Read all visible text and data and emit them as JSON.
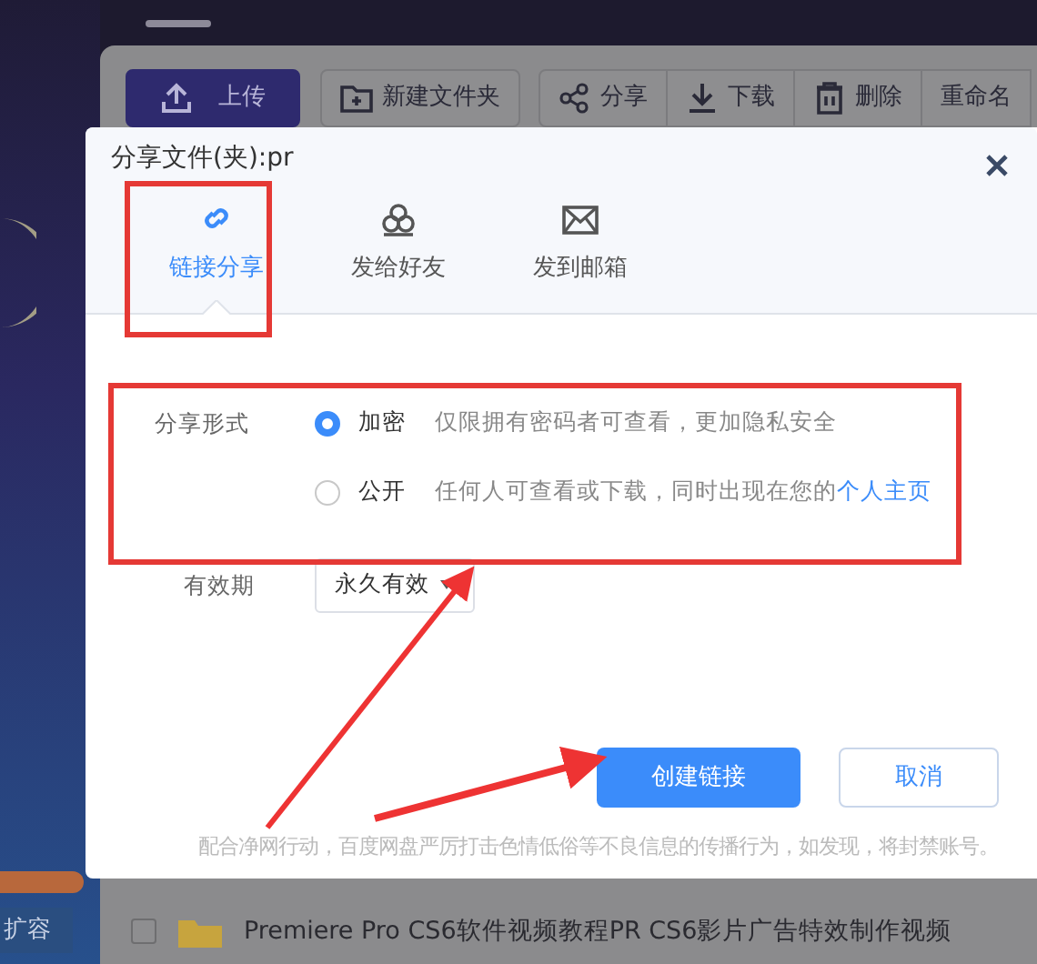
{
  "toolbar": {
    "buttons": [
      {
        "label": "上传",
        "kind": "primary"
      },
      {
        "label": "新建文件夹",
        "kind": "single"
      },
      {
        "label": "分享",
        "kind": "group"
      },
      {
        "label": "下载",
        "kind": "group"
      },
      {
        "label": "删除",
        "kind": "group"
      },
      {
        "label": "重命名",
        "kind": "group"
      }
    ]
  },
  "sidebar": {
    "expand_button": "扩容"
  },
  "files": [
    {
      "name": "Premiere Pro CS6软件视频教程PR CS6影片广告特效制作视频",
      "checked": false
    }
  ],
  "dialog": {
    "title": "分享文件(夹):pr",
    "tabs": [
      {
        "label": "链接分享",
        "selected": true
      },
      {
        "label": "发给好友",
        "selected": false
      },
      {
        "label": "发到邮箱",
        "selected": false
      }
    ],
    "share_mode": {
      "label": "分享形式",
      "options": [
        {
          "label": "加密",
          "description": "仅限拥有密码者可查看，更加隐私安全",
          "selected": true
        },
        {
          "label": "公开",
          "description": "任何人可查看或下载，同时出现在您的",
          "link": "个人主页",
          "selected": false
        }
      ]
    },
    "validity": {
      "label": "有效期",
      "value": "永久有效"
    },
    "buttons": [
      {
        "label": "创建链接",
        "kind": "primary"
      },
      {
        "label": "取消",
        "kind": "secondary"
      }
    ],
    "notice": "配合净网行动，百度网盘严厉打击色情低俗等不良信息的传播行为，如发现，将封禁账号。"
  }
}
